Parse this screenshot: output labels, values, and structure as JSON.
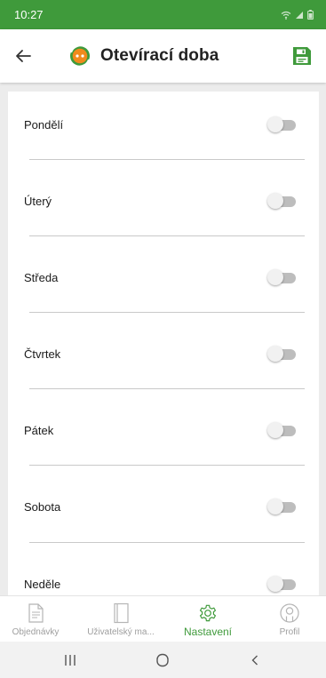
{
  "status_bar": {
    "time": "10:27"
  },
  "app_bar": {
    "title": "Otevírací doba",
    "back_icon": "arrow-left-icon",
    "logo_icon": "app-logo-icon",
    "save_icon": "save-icon"
  },
  "days": [
    {
      "label": "Pondělí",
      "enabled": false
    },
    {
      "label": "Úterý",
      "enabled": false
    },
    {
      "label": "Středa",
      "enabled": false
    },
    {
      "label": "Čtvrtek",
      "enabled": false
    },
    {
      "label": "Pátek",
      "enabled": false
    },
    {
      "label": "Sobota",
      "enabled": false
    },
    {
      "label": "Neděle",
      "enabled": false
    }
  ],
  "bottom_nav": {
    "items": [
      {
        "label": "Objednávky",
        "icon": "document-icon",
        "active": false
      },
      {
        "label": "Uživatelský ma...",
        "icon": "book-icon",
        "active": false
      },
      {
        "label": "Nastavení",
        "icon": "gear-icon",
        "active": true
      },
      {
        "label": "Profil",
        "icon": "profile-icon",
        "active": false
      }
    ]
  },
  "colors": {
    "brand_green": "#3f9a3b",
    "logo_orange": "#f08a1c",
    "toggle_off": "#bdbdbd",
    "inactive_nav": "#9e9e9e"
  }
}
